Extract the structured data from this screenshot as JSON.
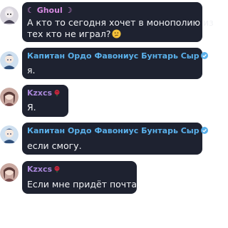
{
  "messages": [
    {
      "author": "☾ Ghoul ☽",
      "text_line1": "А кто то сегодня хочет в монополию из",
      "text_line2": "тех кто не играл?",
      "emoji": "thinking-face-icon"
    },
    {
      "author": "Капитан Ордо Фавониус Бунтарь Сыр",
      "badge": "verified-icon",
      "text": "я."
    },
    {
      "author": "Kzxcs",
      "badge": "rose-icon",
      "text": "Я."
    },
    {
      "author": "Капитан Ордо Фавониус Бунтарь Сыр",
      "badge": "verified-icon",
      "text": "если смогу."
    },
    {
      "author": "Kzxcs",
      "badge": "rose-icon",
      "text": "Если мне придёт почта."
    }
  ],
  "colors": {
    "bubble": "#1e2230",
    "ghoul_name": "#d58ae0",
    "captain_name": "#5ab0ea",
    "kzx_name": "#a987d9",
    "text": "#f1f2f5"
  }
}
